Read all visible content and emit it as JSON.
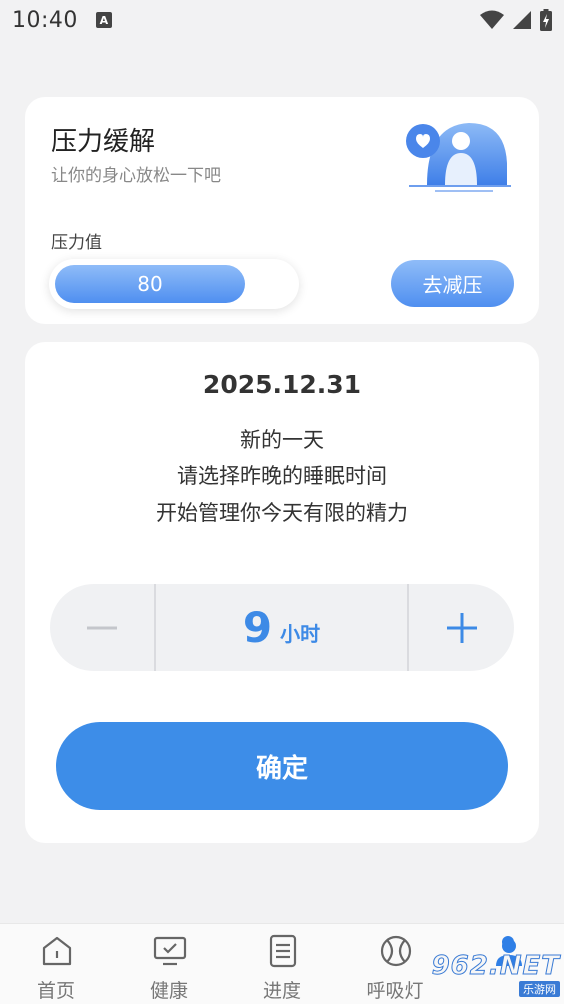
{
  "status_bar": {
    "time": "10:40",
    "badge": "A",
    "icons": [
      "wifi-icon",
      "signal-icon",
      "battery-charging-icon"
    ]
  },
  "stress_card": {
    "title": "压力缓解",
    "subtitle": "让你的身心放松一下吧",
    "value_label": "压力值",
    "value": "80",
    "value_fraction": 0.8,
    "action_label": "去减压",
    "accent": "#4f8ff0"
  },
  "sleep_card": {
    "date": "2025.12.31",
    "message_lines": [
      "新的一天",
      "请选择昨晚的睡眠时间",
      "开始管理你今天有限的精力"
    ],
    "hours": "9",
    "unit": "小时",
    "confirm_label": "确定",
    "accent": "#3d8de8"
  },
  "tabbar": {
    "tabs": [
      {
        "label": "首页",
        "icon": "home-icon"
      },
      {
        "label": "健康",
        "icon": "monitor-check-icon"
      },
      {
        "label": "进度",
        "icon": "document-icon"
      },
      {
        "label": "呼吸灯",
        "icon": "ball-icon"
      },
      {
        "label": "",
        "icon": "profile-icon"
      }
    ]
  },
  "watermark": {
    "big": "962.NET",
    "small": "乐游网"
  }
}
